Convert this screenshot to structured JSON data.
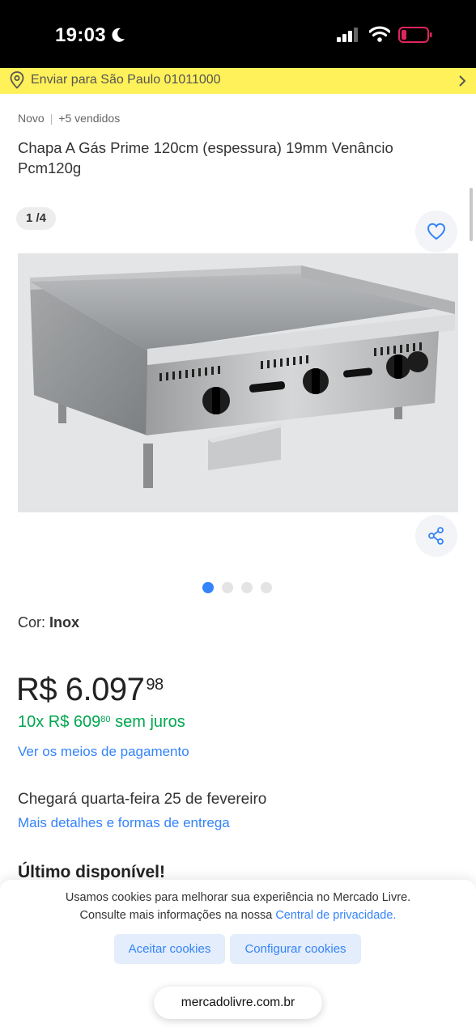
{
  "status": {
    "time": "19:03",
    "battery_color": "#e0245e"
  },
  "shipping": {
    "text": "Enviar para São Paulo 01011000"
  },
  "product": {
    "condition": "Novo",
    "sold": "+5 vendidos",
    "title": "Chapa A Gás Prime 120cm (espessura) 19mm Venâncio Pcm120g",
    "image_counter": "1 /4",
    "image_count": 4,
    "active_image": 1,
    "color_label": "Cor:",
    "color_value": "Inox"
  },
  "price": {
    "currency_amount": "R$ 6.097",
    "cents": "98",
    "installments_prefix": "10x R$ 609",
    "installments_cents": "80",
    "installments_suffix": "sem juros",
    "payment_link": "Ver os meios de pagamento"
  },
  "delivery": {
    "text": "Chegará quarta-feira 25 de fevereiro",
    "link": "Mais detalhes e formas de entrega"
  },
  "stock": {
    "text": "Último disponível!"
  },
  "cookies": {
    "line1": "Usamos cookies para melhorar sua experiência no Mercado Livre.",
    "line2_prefix": "Consulte mais informações na nossa",
    "line2_link": "Central de privacidade.",
    "accept_label": "Aceitar cookies",
    "configure_label": "Configurar cookies"
  },
  "browser": {
    "url": "mercadolivre.com.br"
  },
  "colors": {
    "accent": "#3483fa",
    "green": "#00a650",
    "brand_yellow": "#fff159"
  },
  "icons": [
    "moon-icon",
    "signal-icon",
    "wifi-icon",
    "battery-icon",
    "location-pin-icon",
    "chevron-right-icon",
    "heart-icon",
    "share-icon"
  ]
}
